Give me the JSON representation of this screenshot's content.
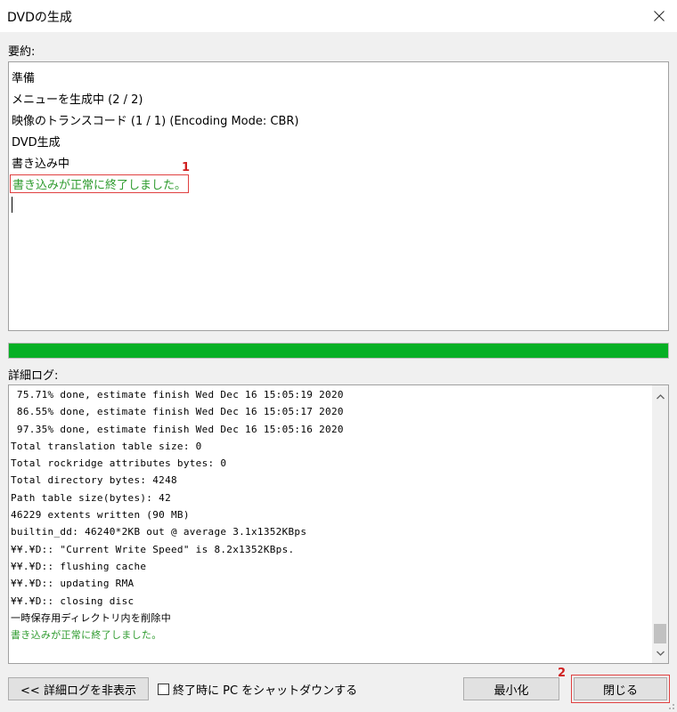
{
  "window": {
    "title": "DVDの生成",
    "close_icon": "close-icon"
  },
  "summary": {
    "label": "要約:",
    "lines": [
      "準備",
      "メニューを生成中 (2 / 2)",
      "映像のトランスコード (1 / 1) (Encoding Mode: CBR)",
      "DVD生成",
      "書き込み中"
    ],
    "success_line": "書き込みが正常に終了しました。",
    "success_color": "#2e9b2e"
  },
  "annotations": {
    "marker1": "1",
    "marker2": "2",
    "highlight_color": "#e04040"
  },
  "progress": {
    "fraction": 1.0,
    "color": "#06b025"
  },
  "log": {
    "label": "詳細ログ:",
    "lines": [
      " 75.71% done, estimate finish Wed Dec 16 15:05:19 2020",
      " 86.55% done, estimate finish Wed Dec 16 15:05:17 2020",
      " 97.35% done, estimate finish Wed Dec 16 15:05:16 2020",
      "Total translation table size: 0",
      "Total rockridge attributes bytes: 0",
      "Total directory bytes: 4248",
      "Path table size(bytes): 42",
      "46229 extents written (90 MB)",
      "builtin_dd: 46240*2KB out @ average 3.1x1352KBps",
      "¥¥.¥D:: \"Current Write Speed\" is 8.2x1352KBps.",
      "¥¥.¥D:: flushing cache",
      "¥¥.¥D:: updating RMA",
      "¥¥.¥D:: closing disc",
      "一時保存用ディレクトリ内を削除中"
    ],
    "success_line": "書き込みが正常に終了しました。",
    "scroll_up_icon": "chevron-up-icon",
    "scroll_down_icon": "chevron-down-icon"
  },
  "footer": {
    "hide_log_button": "<< 詳細ログを非表示",
    "shutdown_checkbox_label": "終了時に PC をシャットダウンする",
    "shutdown_checked": false,
    "minimize_button": "最小化",
    "close_button": "閉じる"
  }
}
